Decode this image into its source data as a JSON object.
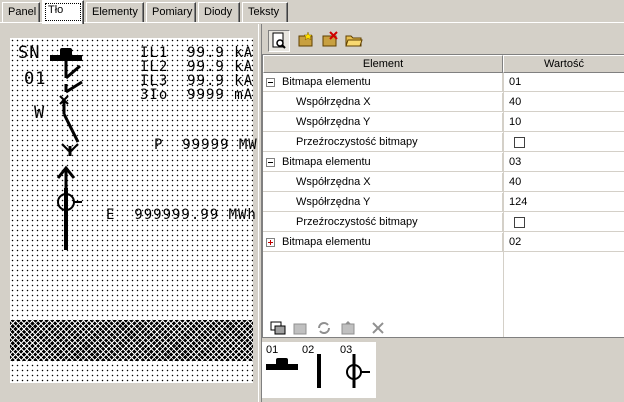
{
  "tabs": [
    "Panel",
    "Tło",
    "Elementy",
    "Pomiary",
    "Diody",
    "Teksty"
  ],
  "active_tab": "Tło",
  "preview": {
    "sn_label": "SN",
    "num_label": "01",
    "w_label": "W",
    "readings": [
      "IL1  99.9 kA",
      "IL2  99.9 kA",
      "IL3  99.9 kA",
      "3Io  9999 mA"
    ],
    "power": "P  99999 MW",
    "energy": "E  999999.99 MWh"
  },
  "grid": {
    "headers": {
      "element": "Element",
      "value": "Wartość"
    },
    "rows": [
      {
        "label": "Bitmapa elementu",
        "value": "01",
        "level": 0,
        "expander": "minus"
      },
      {
        "label": "Współrzędna X",
        "value": "40",
        "level": 1
      },
      {
        "label": "Współrzędna Y",
        "value": "10",
        "level": 1
      },
      {
        "label": "Przeźroczystość bitmapy",
        "value": "",
        "level": 1,
        "checkbox": true
      },
      {
        "label": "Bitmapa elementu",
        "value": "03",
        "level": 0,
        "expander": "minus"
      },
      {
        "label": "Współrzędna X",
        "value": "40",
        "level": 1
      },
      {
        "label": "Współrzędna Y",
        "value": "124",
        "level": 1
      },
      {
        "label": "Przeźroczystość bitmapy",
        "value": "",
        "level": 1,
        "checkbox": true
      },
      {
        "label": "Bitmapa elementu",
        "value": "02",
        "level": 0,
        "expander": "plus"
      }
    ]
  },
  "bitmaps": [
    "01",
    "02",
    "03"
  ]
}
